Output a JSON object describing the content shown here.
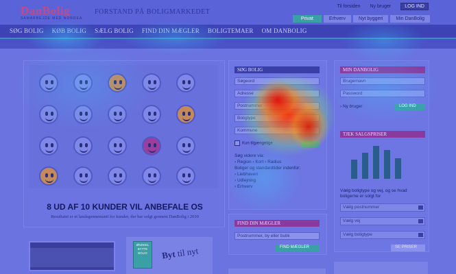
{
  "header": {
    "logo": "DanBolig",
    "logo_sub": "SAMARBEJDE MED NORDEA",
    "tagline": "FORSTAND PÅ BOLIGMARKEDET",
    "top_links": [
      "Til forsiden",
      "Ny bruger"
    ],
    "login_label": "LOG IND",
    "tabs": [
      "Privat",
      "Erhverv",
      "Nyt byggeri",
      "Min DanBolig"
    ]
  },
  "nav": [
    "SØG BOLIG",
    "KØB BOLIG",
    "SÆLG BOLIG",
    "FIND DIN MÆGLER",
    "BOLIGTEMAER",
    "OM DANBOLIG"
  ],
  "hero": {
    "headline": "8 UD AF 10 KUNDER VIL ANBEFALE OS",
    "subline": "Resultatet er et landsgennemsnit for kunder, der har solgt gennem DanBolig i 2010"
  },
  "onske": {
    "badge": "ØNSKEL BYTTE BOLIG",
    "title_bold": "Byt",
    "title_rest": "til nyt"
  },
  "search": {
    "title": "SØG BOLIG",
    "fields": [
      "Søgeord",
      "Adresse",
      "Postnummer",
      "Boligtype",
      "Kommune"
    ],
    "checkbox": "Kun tilgængelige",
    "links": [
      "Søg videre via:",
      "› Region",
      "› Kort",
      "› Radius",
      "Boliger og standardtider indenfor:",
      "› Liebhaveri",
      "› Udlejning",
      "› Erhverv"
    ]
  },
  "find_maegler": {
    "title": "FIND DIN MÆGLER",
    "placeholder": "Postnummer, by eller butik",
    "button": "FIND MÆGLER"
  },
  "min_danbolig": {
    "title": "MIN DANBOLIG",
    "fields": [
      "Brugernavn",
      "Password"
    ],
    "new_user": "› Ny bruger",
    "login": "LOG IND"
  },
  "prices": {
    "title": "TJEK SALGSPRISER",
    "description": "Vælg boligtype og vej, og se hvad boligerne er solgt for",
    "selects": [
      "Vælg postnummer",
      "Vælg vej",
      "Vælg boligtype"
    ],
    "button": "SE PRISER"
  }
}
